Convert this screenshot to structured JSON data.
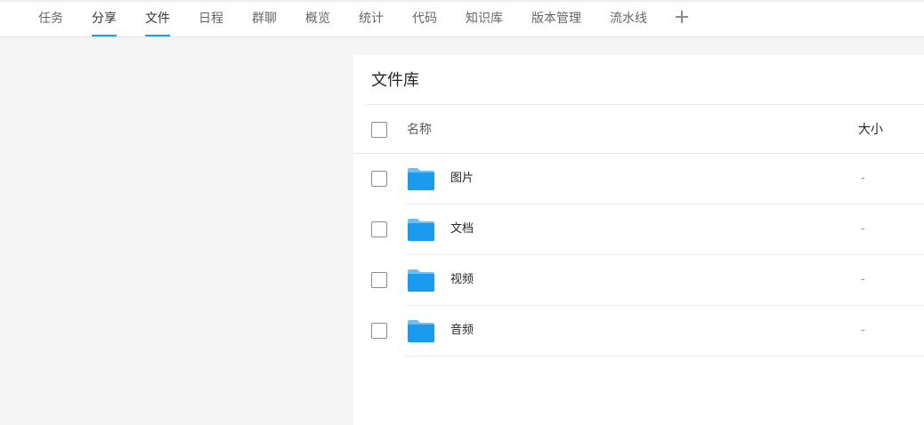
{
  "tabs": [
    {
      "label": "任务",
      "active": false
    },
    {
      "label": "分享",
      "active": true
    },
    {
      "label": "文件",
      "active": true
    },
    {
      "label": "日程",
      "active": false
    },
    {
      "label": "群聊",
      "active": false
    },
    {
      "label": "概览",
      "active": false
    },
    {
      "label": "统计",
      "active": false
    },
    {
      "label": "代码",
      "active": false
    },
    {
      "label": "知识库",
      "active": false
    },
    {
      "label": "版本管理",
      "active": false
    },
    {
      "label": "流水线",
      "active": false
    }
  ],
  "add_tab_icon": "plus-icon",
  "library": {
    "title": "文件库",
    "columns": {
      "name": "名称",
      "size": "大小"
    },
    "rows": [
      {
        "name": "图片",
        "size": "-",
        "icon": "folder-icon"
      },
      {
        "name": "文档",
        "size": "-",
        "icon": "folder-icon"
      },
      {
        "name": "视频",
        "size": "-",
        "icon": "folder-icon"
      },
      {
        "name": "音频",
        "size": "-",
        "icon": "folder-icon"
      }
    ]
  },
  "colors": {
    "accent": "#1b9aee",
    "folder": "#1b9aee",
    "folder_tab": "#6cc0f5",
    "background": "#f5f5f5"
  }
}
